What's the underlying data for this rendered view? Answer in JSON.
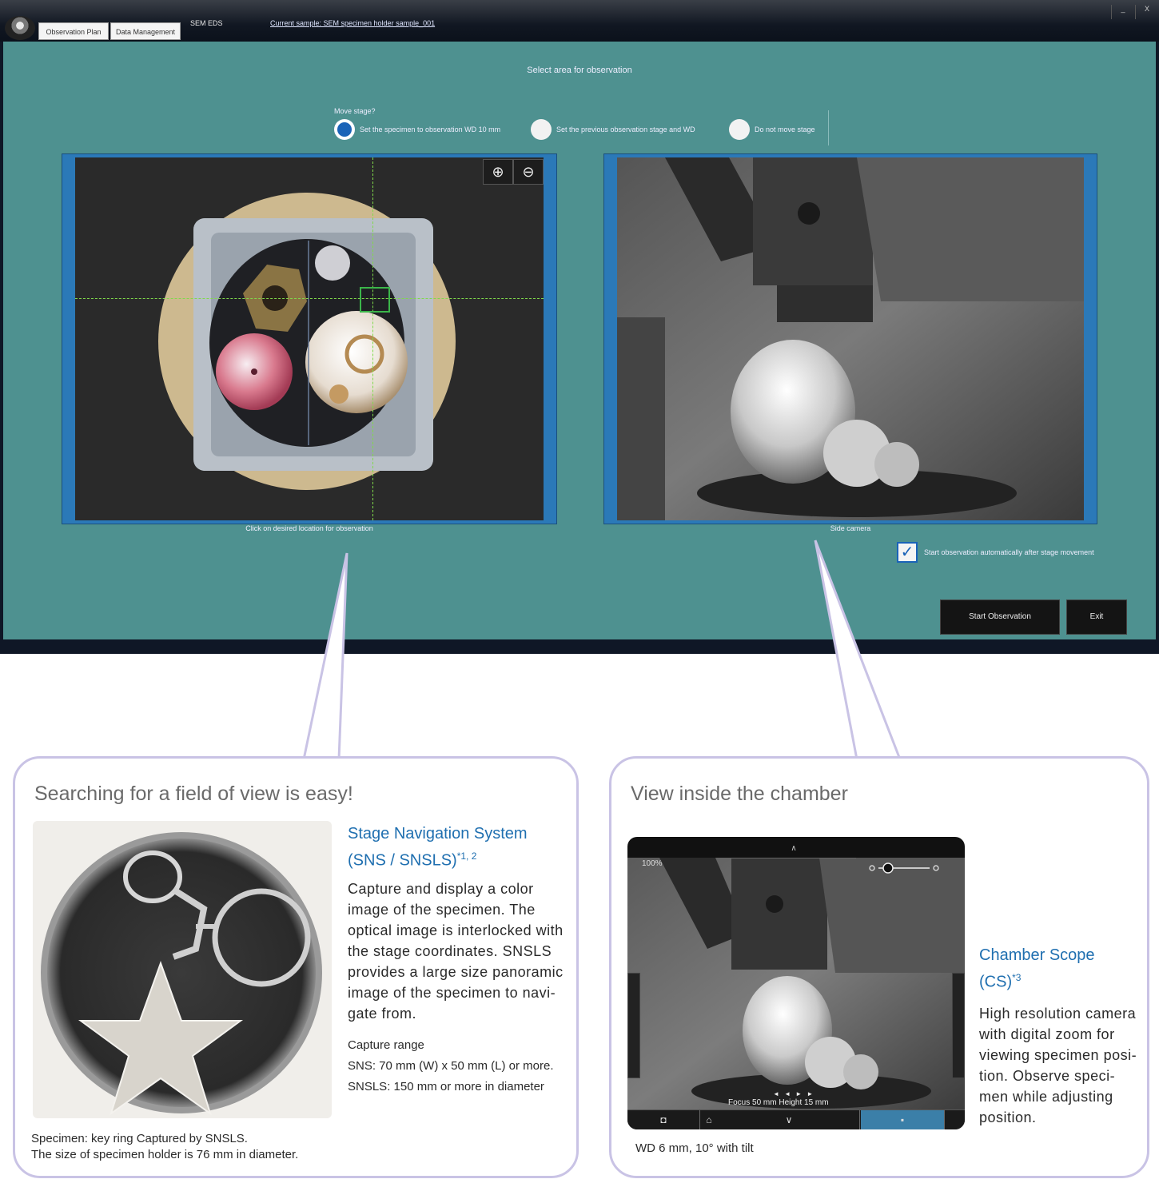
{
  "app": {
    "tabs": [
      "Observation Plan",
      "Data Management"
    ],
    "title_info": "SEM   EDS",
    "title_link": "Current sample: SEM specimen holder sample_001",
    "window_controls": [
      "_",
      "X"
    ],
    "prompt": "Select area for observation",
    "radio_group_title": "Move stage?",
    "radio_options": [
      {
        "label": "Set the specimen to observation WD 10 mm",
        "selected": true
      },
      {
        "label": "Set the previous observation stage and WD",
        "selected": false
      },
      {
        "label": "Do not move stage",
        "selected": false
      }
    ],
    "left_caption": "Click on desired location for observation",
    "right_caption": "Side camera",
    "zoom_in_symbol": "⊕",
    "zoom_out_symbol": "⊖",
    "checkbox_label": "Start observation automatically after stage movement",
    "checkbox_checked": true,
    "start_button": "Start Observation",
    "exit_button": "Exit"
  },
  "left_callout": {
    "heading": "Searching for a field of view is easy!",
    "subtitle_line1": "Stage Navigation System",
    "subtitle_line2": "(SNS / SNSLS)",
    "subtitle_sup": "*1, 2",
    "body": "Capture and display a color image of the specimen. The optical image is interlocked with the stage coordinates. SNSLS provides a large size panoramic image of the specimen to navi-gate from.",
    "range_title": "Capture range",
    "range_sns": "SNS: 70 mm (W) x 50 mm (L) or more.",
    "range_snsls": "SNSLS: 150 mm or more in diameter",
    "caption_line1": "Specimen: key ring Captured by SNSLS.",
    "caption_line2": "The size of specimen holder is 76 mm in diameter."
  },
  "right_callout": {
    "heading": "View inside the chamber",
    "subtitle_line1": "Chamber Scope",
    "subtitle_line2": "(CS)",
    "subtitle_sup": "*3",
    "body": "High resolution camera with digital zoom for viewing specimen posi-tion. Observe speci-men while adjusting position.",
    "caption": "WD 6 mm, 10° with tilt",
    "cs_ui": {
      "top_label": "∧",
      "zoom_pct": "100%",
      "readout": "Focus 50 mm   Height 15 mm",
      "arrows": "◄ ◄ ► ►"
    }
  },
  "colors": {
    "panel": "#4e9190",
    "view_frame": "#2b79b8",
    "callout_border": "#c9c3e5",
    "subtitle_blue": "#1f6fb0",
    "crosshair": "#7fd94a"
  }
}
